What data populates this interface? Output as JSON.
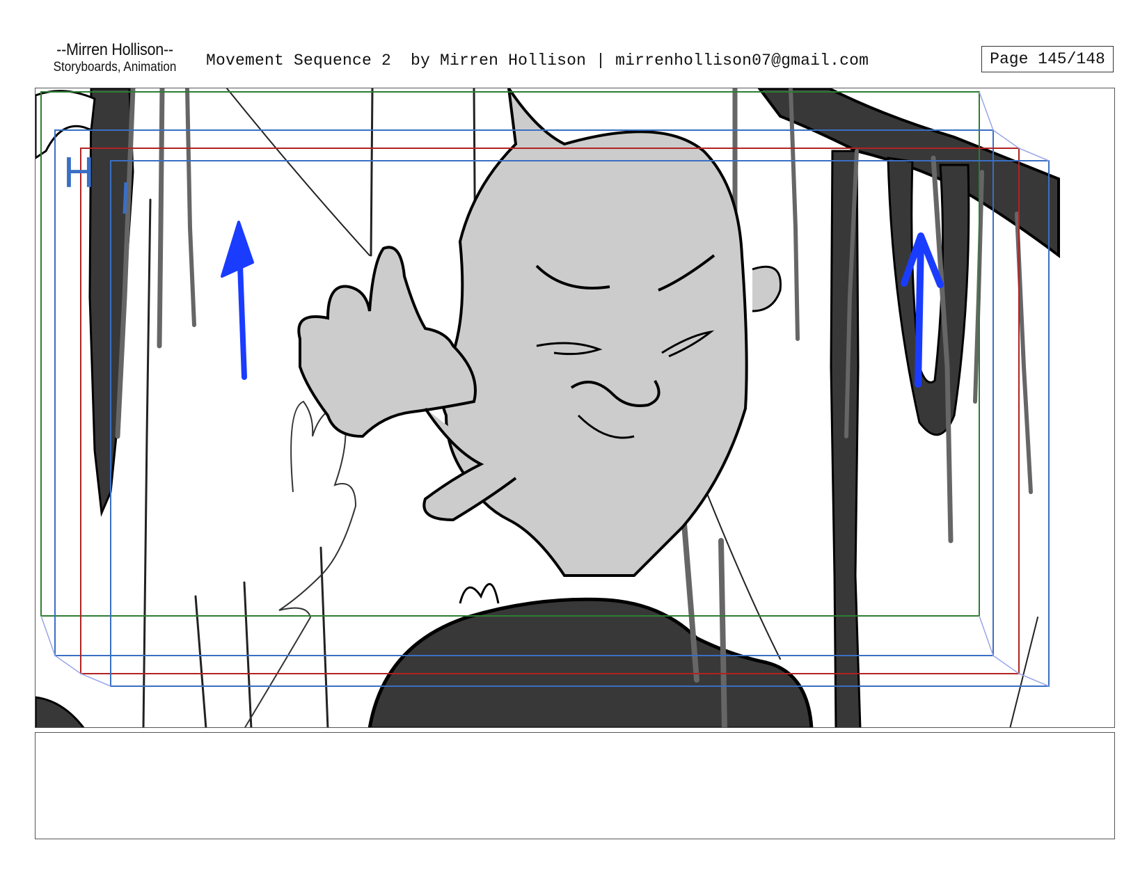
{
  "header": {
    "logo_name": "--Mirren Hollison--",
    "logo_subtitle": "Storyboards, Animation",
    "title_line": "Movement Sequence 2  by Mirren Hollison | mirrenhollison07@gmail.com",
    "page_label": "Page 145/148"
  },
  "panel": {
    "frame_marker": "H",
    "colors": {
      "action_safe": "#2e7d32",
      "title_safe": "#3a6fc4",
      "camera_frame": "#b22222",
      "arrow": "#1a3cff",
      "fill_dark": "#383838",
      "fill_light": "#cccccc"
    }
  },
  "notes": {
    "text": ""
  }
}
